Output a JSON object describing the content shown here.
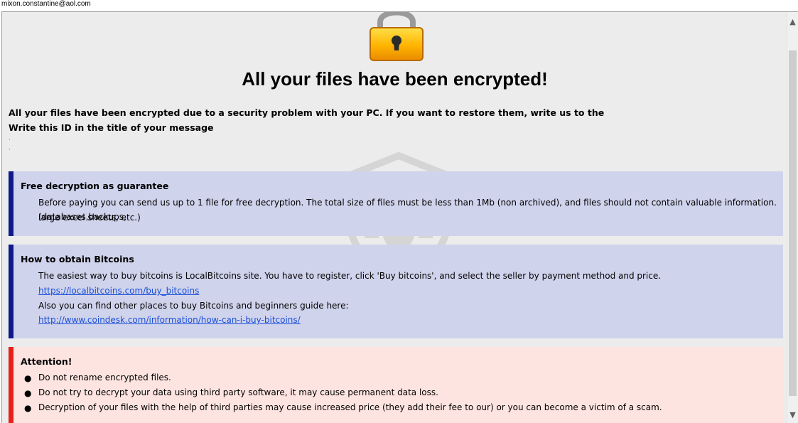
{
  "titlebar": {
    "email": "mixon.constantine@aol.com"
  },
  "header": {
    "headline": "All your files have been encrypted!"
  },
  "intro": {
    "line1": "All your files have been encrypted due to a security problem with your PC. If you want to restore them, write us to the",
    "line2": "Write this ID in the title of your message"
  },
  "free_decryption": {
    "title": "Free decryption as guarantee",
    "line1": "Before paying you can send us up to 1 file for free decryption. The total size of files must be less than 1Mb (non archived), and files should not contain valuable information. (databases,backups,",
    "line2": "large excel sheets, etc.)"
  },
  "bitcoins": {
    "title": "How to obtain Bitcoins",
    "line1": "The easiest way to buy bitcoins is LocalBitcoins site. You have to register, click 'Buy bitcoins', and select the seller by payment method and price.",
    "link1": "https://localbitcoins.com/buy_bitcoins",
    "line2": "Also you can find other places to buy Bitcoins and beginners guide here:",
    "link2": "http://www.coindesk.com/information/how-can-i-buy-bitcoins/"
  },
  "attention": {
    "title": "Attention!",
    "items": [
      "Do not rename encrypted files.",
      "Do not try to decrypt your data using third party software, it may cause permanent data loss.",
      "Decryption of your files with the help of third parties may cause increased price (they add their fee to our) or you can become a victim of a scam."
    ]
  },
  "icons": {
    "lock": "padlock-icon",
    "watermark": "shield-bug-icon",
    "scroll_up": "chevron-up-icon",
    "scroll_down": "chevron-down-icon"
  },
  "colors": {
    "blue_accent": "#0f1a8a",
    "red_accent": "#e8201a",
    "blue_panel": "#d0d3ec",
    "red_panel": "#fde4e0",
    "link": "#1a4fd8"
  }
}
